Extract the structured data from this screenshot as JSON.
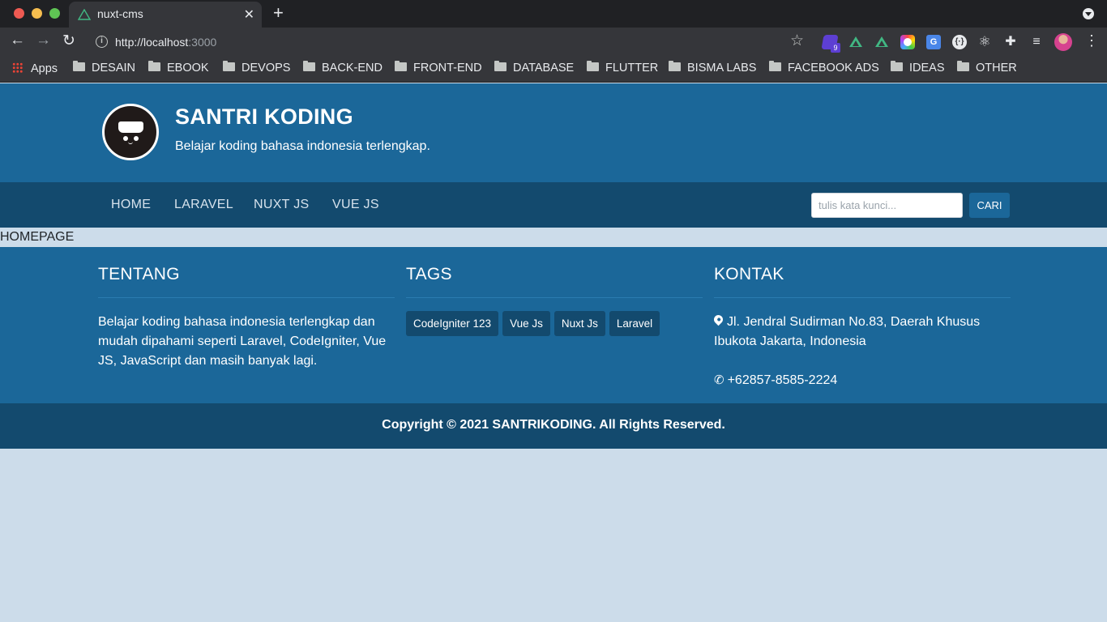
{
  "browser": {
    "tab_title": "nuxt-cms",
    "tab_close": "✕",
    "new_tab": "+",
    "url_host": "http://localhost",
    "url_port": ":3000",
    "extension_badge": "9",
    "bookmarks": [
      {
        "label": "Apps",
        "type": "apps"
      },
      {
        "label": "DESAIN",
        "type": "folder"
      },
      {
        "label": "EBOOK",
        "type": "folder"
      },
      {
        "label": "DEVOPS",
        "type": "folder"
      },
      {
        "label": "BACK-END",
        "type": "folder"
      },
      {
        "label": "FRONT-END",
        "type": "folder"
      },
      {
        "label": "DATABASE",
        "type": "folder"
      },
      {
        "label": "FLUTTER",
        "type": "folder"
      },
      {
        "label": "BISMA LABS",
        "type": "folder"
      },
      {
        "label": "FACEBOOK ADS",
        "type": "folder"
      },
      {
        "label": "IDEAS",
        "type": "folder"
      },
      {
        "label": "OTHER",
        "type": "folder"
      }
    ]
  },
  "header": {
    "title": "SANTRI KODING",
    "tagline": "Belajar koding bahasa indonesia terlengkap."
  },
  "nav": {
    "items": [
      "HOME",
      "LARAVEL",
      "NUXT JS",
      "VUE JS"
    ],
    "search_placeholder": "tulis kata kunci...",
    "search_button": "CARI"
  },
  "main": {
    "page_label": "HOMEPAGE"
  },
  "footer": {
    "about": {
      "title": "TENTANG",
      "text": "Belajar koding bahasa indonesia terlengkap dan mudah dipahami seperti Laravel, CodeIgniter, Vue JS, JavaScript dan masih banyak lagi."
    },
    "tags": {
      "title": "TAGS",
      "items": [
        "CodeIgniter 123",
        "Vue Js",
        "Nuxt Js",
        "Laravel"
      ]
    },
    "contact": {
      "title": "KONTAK",
      "address": "Jl. Jendral Sudirman No.83, Daerah Khusus Ibukota Jakarta, Indonesia",
      "phone": "+62857-8585-2224"
    },
    "copyright": "Copyright © 2021 SANTRIKODING. All Rights Reserved."
  },
  "colors": {
    "header_bg": "#1b6799",
    "nav_bg": "#134a6e",
    "page_bg": "#ccdcea"
  }
}
